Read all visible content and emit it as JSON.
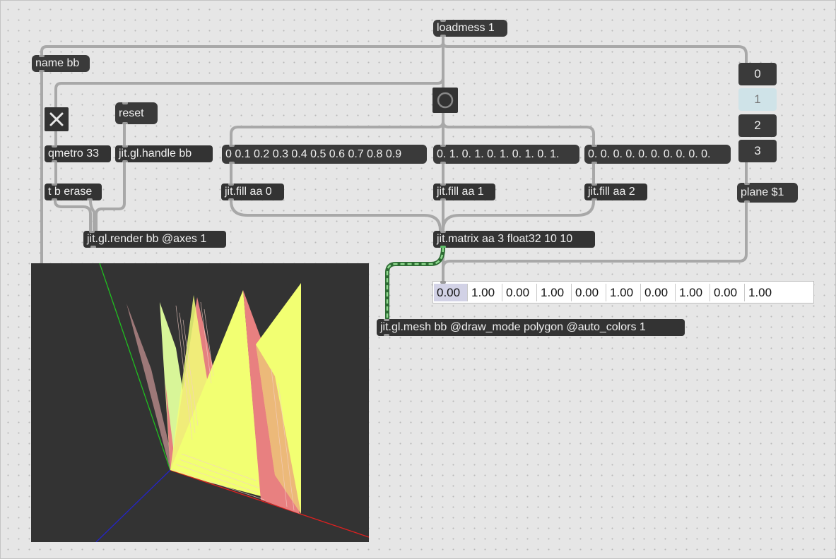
{
  "objects": {
    "loadmess": "loadmess 1",
    "name": "name bb",
    "reset": "reset",
    "qmetro": "qmetro 33",
    "handle": "jit.gl.handle bb",
    "tberase": "t b erase",
    "render": "jit.gl.render bb @axes 1",
    "msg0": "0 0.1 0.2 0.3 0.4 0.5 0.6 0.7 0.8 0.9",
    "msg1": "0. 1. 0. 1. 0. 1. 0. 1. 0. 1.",
    "msg2": "0. 0. 0. 0. 0. 0. 0. 0. 0. 0.",
    "fill0": "jit.fill aa 0",
    "fill1": "jit.fill aa 1",
    "fill2": "jit.fill aa 2",
    "matrix": "jit.matrix aa 3 float32 10 10",
    "mesh": "jit.gl.mesh bb @draw_mode polygon @auto_colors 1",
    "plane": "plane $1"
  },
  "toggle_state": "on",
  "plane_menu": {
    "items": [
      "0",
      "1",
      "2",
      "3"
    ],
    "selected": "1"
  },
  "multislider_values": [
    "0.00",
    "1.00",
    "0.00",
    "1.00",
    "0.00",
    "1.00",
    "0.00",
    "1.00",
    "0.00",
    "1.00"
  ],
  "colors": {
    "canvas": "#e6e6e6",
    "object_bg": "#333333",
    "patch_cord": "#a8a8a8",
    "matrix_cord": "#5fbf6a",
    "scene_bg": "#333333",
    "mesh_yellow": "#f5ff70",
    "mesh_pink": "#e88080",
    "axis_x": "#dd2222",
    "axis_y": "#22cc22",
    "axis_z": "#2222cc"
  }
}
